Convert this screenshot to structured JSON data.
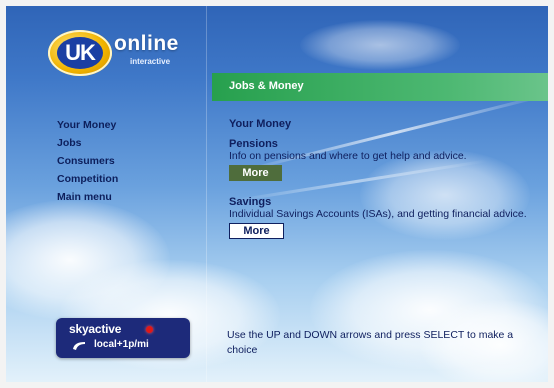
{
  "logo": {
    "brand_mark": "UK",
    "brand_word": "online",
    "tagline": "interactive"
  },
  "nav": {
    "items": [
      {
        "label": "Your Money"
      },
      {
        "label": "Jobs"
      },
      {
        "label": "Consumers"
      },
      {
        "label": "Competition"
      },
      {
        "label": "Main menu"
      }
    ]
  },
  "badge": {
    "brand": "skyactive",
    "phone_icon": "phone-handset-icon",
    "rate": "local+1p/mi"
  },
  "header": {
    "title": "Jobs & Money"
  },
  "main": {
    "heading": "Your Money",
    "sections": [
      {
        "title": "Pensions",
        "description": "Info on pensions and where to get help and advice.",
        "button_label": "More"
      },
      {
        "title": "Savings",
        "description": "Individual Savings Accounts (ISAs), and getting financial advice.",
        "button_label": "More"
      }
    ]
  },
  "footer": {
    "hint": "Use the UP and DOWN arrows and press SELECT to make a choice"
  },
  "colors": {
    "sky_top": "#2e63b6",
    "title_bar": "#27a04e",
    "text_navy": "#0f1f5e",
    "button_primary": "#4f6d3c",
    "badge_bg": "#1d2a7a",
    "dot_red": "#e01818"
  }
}
